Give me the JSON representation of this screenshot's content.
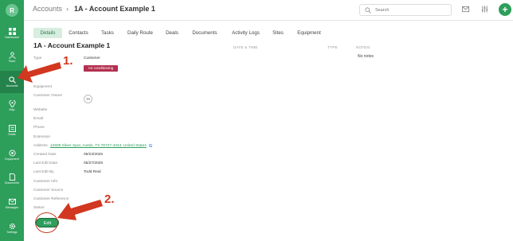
{
  "sidebar": {
    "logo": "R",
    "items": [
      {
        "label": "Dashboard",
        "icon": "grid-icon"
      },
      {
        "label": "Team",
        "icon": "people-icon"
      },
      {
        "label": "Accounts",
        "icon": "search-icon"
      },
      {
        "label": "Map",
        "icon": "map-pin-icon"
      },
      {
        "label": "Deals",
        "icon": "deals-icon"
      },
      {
        "label": "Equipment",
        "icon": "equipment-icon"
      },
      {
        "label": "Documents",
        "icon": "document-icon"
      },
      {
        "label": "Messages",
        "icon": "mail-icon"
      },
      {
        "label": "Settings",
        "icon": "gear-icon"
      }
    ]
  },
  "header": {
    "breadcrumb_root": "Accounts",
    "breadcrumb_sep": "›",
    "title": "1A - Account Example 1",
    "search_placeholder": "Search",
    "add_label": "+"
  },
  "tabs": [
    "Details",
    "Contacts",
    "Tasks",
    "Daily Route",
    "Deals",
    "Documents",
    "Activity Logs",
    "Sites",
    "Equipment"
  ],
  "details": {
    "title": "1A - Account Example 1",
    "fields": {
      "type_label": "Type",
      "type_value": "Customer",
      "type_tag": "Air conditioning",
      "equipment_label": "Equipment",
      "owner_label": "Customer Owner",
      "owner_initials": "TR",
      "website_label": "Website",
      "email_label": "Email",
      "phone_label": "Phone",
      "extension_label": "Extension",
      "address_label": "Address",
      "address_value": "12508 Silver Spur, Austin, TX 78727-4343, United States",
      "created_date_label": "Created Date",
      "created_date_value": "05/23/2025",
      "last_edit_date_label": "Last Edit Date",
      "last_edit_date_value": "05/27/2025",
      "last_edit_by_label": "Last Edit By",
      "last_edit_by_value": "Todd Reid",
      "customer_info_label": "Customer Info",
      "customer_source_label": "Customer Source",
      "customer_reference_label": "Customer Reference",
      "status_label": "Status"
    },
    "edit_label": "Edit"
  },
  "notes_panel": {
    "col_date": "DATE & TIME",
    "col_type": "TYPE",
    "col_notes": "NOTES",
    "empty": "No notes"
  },
  "annotations": {
    "step1": "1.",
    "step2": "2.",
    "color": "#d2371f"
  },
  "colors": {
    "brand_green": "#2e9e5b",
    "tag_red": "#b3304f"
  }
}
